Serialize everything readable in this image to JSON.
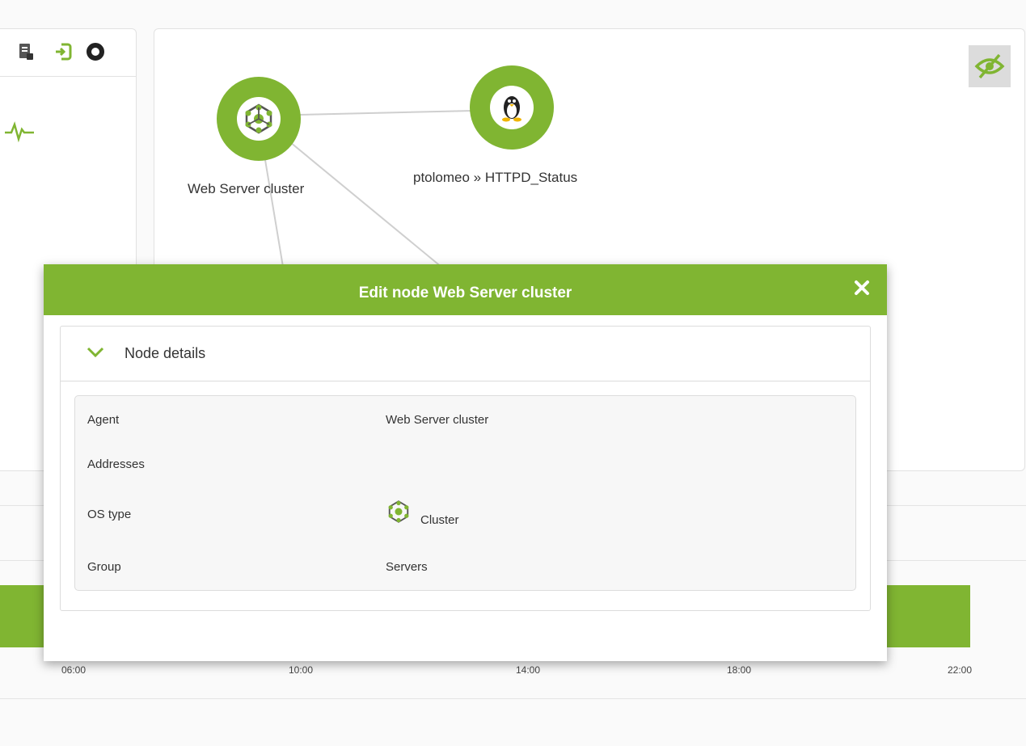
{
  "map": {
    "nodes": [
      {
        "label": "Web Server cluster",
        "icon": "cluster-icon"
      },
      {
        "label": "ptolomeo » HTTPD_Status",
        "icon": "linux-tux-icon"
      }
    ],
    "hide_button_icon": "eye-slash-icon"
  },
  "toolbar": {
    "icons": [
      "document-icon",
      "login-icon",
      "ring-icon"
    ]
  },
  "timeline": {
    "ticks": [
      "06:00",
      "10:00",
      "14:00",
      "18:00",
      "22:00"
    ]
  },
  "modal": {
    "title": "Edit node Web Server cluster",
    "section_title": "Node details",
    "rows": [
      {
        "label": "Agent",
        "value": "Web Server cluster"
      },
      {
        "label": "Addresses",
        "value": ""
      },
      {
        "label": "OS type",
        "value": "Cluster",
        "icon": "cluster-icon"
      },
      {
        "label": "Group",
        "value": "Servers"
      }
    ]
  },
  "colors": {
    "accent": "#80b532",
    "panel": "#ffffff"
  }
}
